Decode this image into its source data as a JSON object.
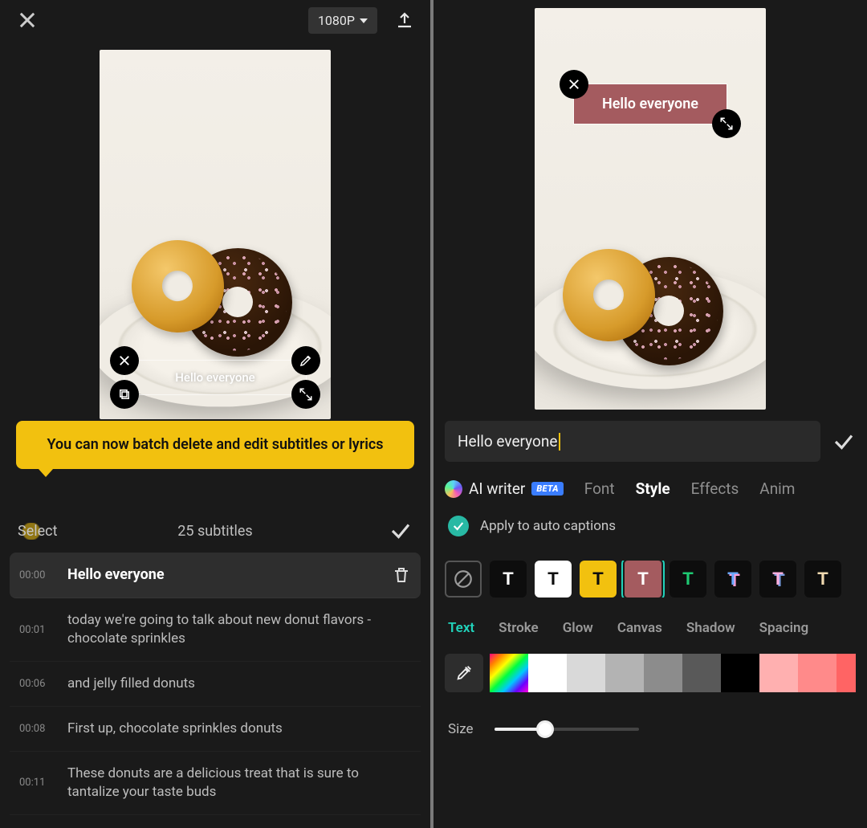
{
  "left": {
    "resolution_label": "1080P",
    "preview_caption": "Hello everyone",
    "tooltip": "You can now batch delete and edit subtitles or lyrics",
    "select_label": "Select",
    "subtitle_count_label": "25 subtitles",
    "selected_subtitle_index": 0,
    "subtitles": [
      {
        "time": "00:00",
        "text": "Hello everyone"
      },
      {
        "time": "00:01",
        "text": "today we're going to talk about new donut flavors - chocolate sprinkles"
      },
      {
        "time": "00:06",
        "text": "and jelly filled donuts"
      },
      {
        "time": "00:08",
        "text": "First up, chocolate sprinkles donuts"
      },
      {
        "time": "00:11",
        "text": "These donuts are a delicious treat that is sure to tantalize your taste buds"
      }
    ]
  },
  "right": {
    "preview_caption": "Hello everyone",
    "text_input": "Hello everyone",
    "tabs": {
      "ai_label": "AI writer",
      "ai_badge": "BETA",
      "font": "Font",
      "style": "Style",
      "effects": "Effects",
      "anim": "Anim"
    },
    "active_tab": "style",
    "apply_label": "Apply to auto captions",
    "preset_glyph": "T",
    "presets": [
      {
        "bg": "#0d0d0d",
        "fg": "#ffffff"
      },
      {
        "bg": "#ffffff",
        "fg": "#0d0d0d"
      },
      {
        "bg": "#f2c10f",
        "fg": "#0d0d0d"
      },
      {
        "bg": "#a45b5f",
        "fg": "#ffffff",
        "selected": true
      },
      {
        "bg": "#0d0d0d",
        "fg": "#1ec972"
      },
      {
        "bg": "#0d0d0d",
        "fg": "#6aa8ff",
        "shadow": "2px 2px 0 #ffa0d8"
      },
      {
        "bg": "#0d0d0d",
        "fg": "#ffb0e0",
        "shadow": "2px 2px 0 #79d"
      },
      {
        "bg": "#0d0d0d",
        "fg": "#f0d9b0"
      }
    ],
    "style_subtabs": [
      "Text",
      "Stroke",
      "Glow",
      "Canvas",
      "Shadow",
      "Spacing"
    ],
    "active_style_subtab": "Text",
    "colors": [
      "#ffffff",
      "#d9d9d9",
      "#b3b3b3",
      "#8c8c8c",
      "#595959",
      "#000000",
      "#ffb0b0",
      "#ff8a8a",
      "#ff6464",
      "#ff3b3b",
      "#ff1414",
      "#d60000"
    ],
    "size_label": "Size",
    "size_value": 35
  }
}
